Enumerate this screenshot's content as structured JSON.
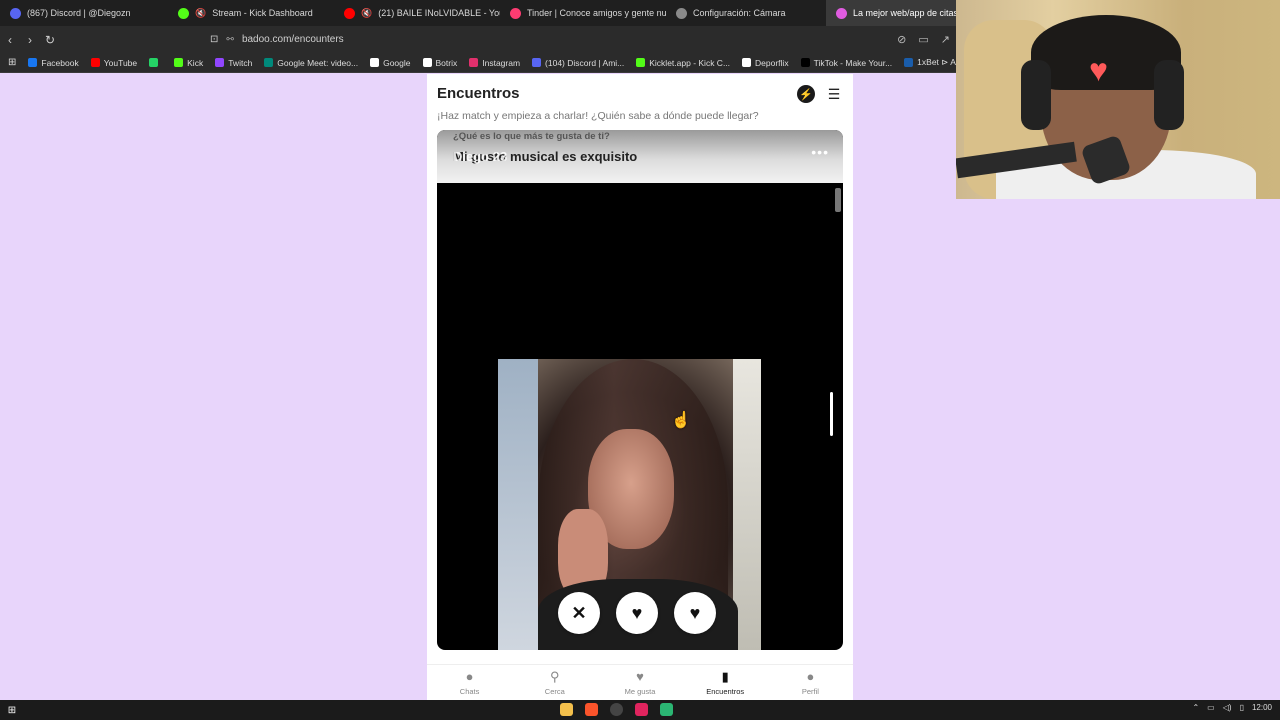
{
  "browser": {
    "tabs": [
      {
        "label": "(867) Discord | @Diegozn",
        "color": "#5865f2",
        "badge": "867",
        "muted": false,
        "active": false
      },
      {
        "label": "Stream - Kick Dashboard",
        "color": "#53fc18",
        "badge": "K",
        "muted": true,
        "active": false
      },
      {
        "label": "(21) BAILE INoLVIDABLE - YouTub",
        "color": "#ff0000",
        "badge": "▶",
        "muted": true,
        "active": false
      },
      {
        "label": "Tinder | Conoce amigos y gente nue",
        "color": "#fe3c72",
        "badge": "",
        "muted": false,
        "active": false
      },
      {
        "label": "Configuración: Cámara",
        "color": "#8a8a8a",
        "badge": "⚙",
        "muted": false,
        "active": false
      },
      {
        "label": "La mejor web/app de citas grat",
        "color": "#e05ce0",
        "badge": "",
        "muted": false,
        "active": true
      }
    ],
    "url": "badoo.com/encounters",
    "bookmarks": [
      {
        "label": "Facebook",
        "color": "#1877f2"
      },
      {
        "label": "YouTube",
        "color": "#ff0000"
      },
      {
        "label": "",
        "color": "#25d366"
      },
      {
        "label": "Kick",
        "color": "#53fc18"
      },
      {
        "label": "Twitch",
        "color": "#9146ff"
      },
      {
        "label": "Google Meet: video...",
        "color": "#00897b"
      },
      {
        "label": "Google",
        "color": "#ffffff"
      },
      {
        "label": "Botrix",
        "color": "#ffffff"
      },
      {
        "label": "Instagram",
        "color": "#e1306c"
      },
      {
        "label": "(104) Discord | Ami...",
        "color": "#5865f2"
      },
      {
        "label": "Kicklet.app - Kick C...",
        "color": "#53fc18"
      },
      {
        "label": "Deporflix",
        "color": "#ffffff"
      },
      {
        "label": "TikTok - Make Your...",
        "color": "#000000"
      },
      {
        "label": "1xBet ⊳ Apues",
        "color": "#1a5dab"
      }
    ]
  },
  "page": {
    "title": "Encuentros",
    "subtitle": "¡Haz match y empieza a charlar! ¿Quién sabe a dónde puede llegar?",
    "question": "¿Qué es lo que más te gusta de ti?",
    "answer": "Mi gusto musical es exquisito",
    "name_overlay": "Diego 23",
    "more_label": "•••"
  },
  "nav": [
    {
      "label": "Chats",
      "icon": "chat-icon",
      "glyph": "●",
      "active": false
    },
    {
      "label": "Cerca",
      "icon": "location-pin-icon",
      "glyph": "⚲",
      "active": false
    },
    {
      "label": "Me gusta",
      "icon": "heart-icon",
      "glyph": "♥",
      "active": false
    },
    {
      "label": "Encuentros",
      "icon": "cards-icon",
      "glyph": "▮",
      "active": true
    },
    {
      "label": "Perfil",
      "icon": "person-icon",
      "glyph": "●",
      "active": false
    }
  ],
  "taskbar": {
    "clock": "12:00"
  }
}
